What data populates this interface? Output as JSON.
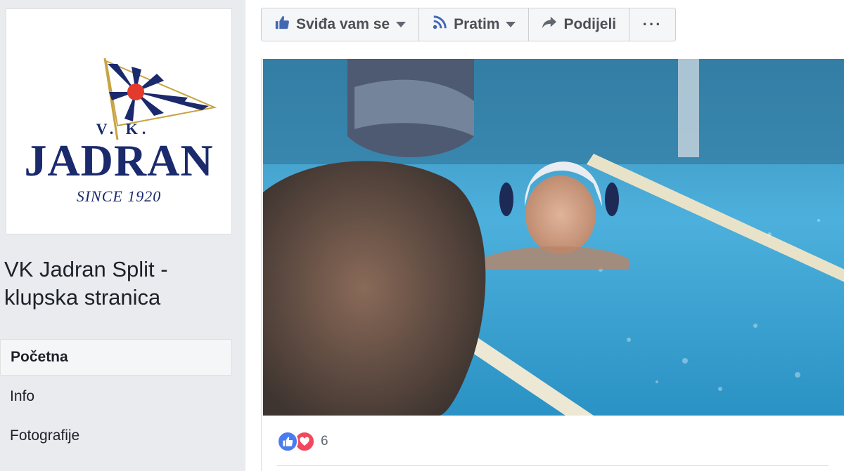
{
  "logo": {
    "vk": "V. K.",
    "name": "JADRAN",
    "since": "SINCE 1920"
  },
  "page": {
    "name": "VK Jadran Split - klupska stranica"
  },
  "nav": {
    "items": [
      {
        "label": "Početna",
        "active": true
      },
      {
        "label": "Info",
        "active": false
      },
      {
        "label": "Fotografije",
        "active": false
      }
    ]
  },
  "toolbar": {
    "like_label": "Sviđa vam se",
    "follow_label": "Pratim",
    "share_label": "Podijeli",
    "more_label": "···"
  },
  "post": {
    "reaction_count": "6"
  },
  "icons": {
    "like": "thumbs-up-icon",
    "follow": "rss-icon",
    "share": "share-arrow-icon",
    "love": "heart-icon"
  },
  "colors": {
    "brand_navy": "#1a2a6c",
    "like_blue": "#4a7cf0",
    "love_red": "#f0495e",
    "page_bg": "#e9ebee"
  }
}
